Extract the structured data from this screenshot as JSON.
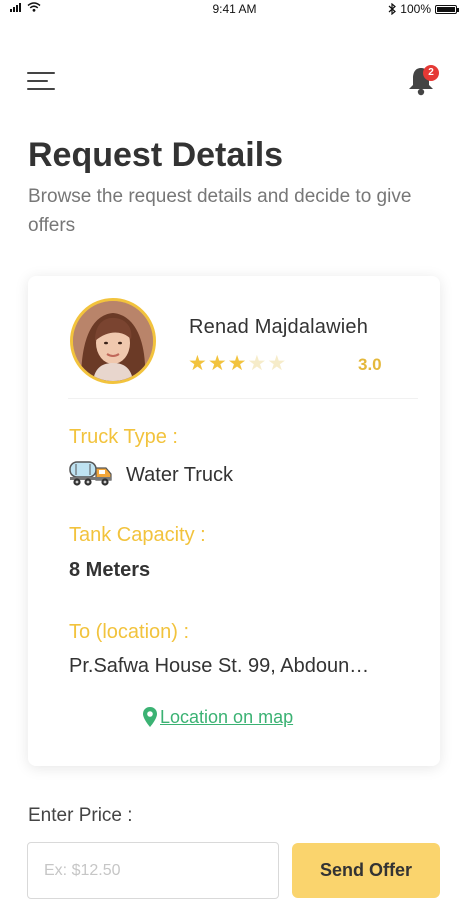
{
  "status_bar": {
    "time": "9:41 AM",
    "battery": "100%"
  },
  "header": {
    "notification_count": "2"
  },
  "page": {
    "title": "Request Details",
    "subtitle": "Browse the request details and decide to give offers"
  },
  "request": {
    "user_name": "Renad Majdalawieh",
    "rating_value": "3.0",
    "rating_stars_filled": 3,
    "rating_stars_total": 5,
    "truck_type_label": "Truck Type :",
    "truck_type_value": "Water Truck",
    "tank_capacity_label": "Tank Capacity :",
    "tank_capacity_value": "8 Meters",
    "location_label": "To (location) :",
    "location_value": "Pr.Safwa House St. 99, Abdoun…",
    "map_link_label": "Location on map"
  },
  "offer": {
    "price_label": "Enter Price :",
    "price_placeholder": "Ex: $12.50",
    "price_value": "",
    "send_button_label": "Send Offer"
  },
  "colors": {
    "accent_yellow": "#f2c33d",
    "button_yellow": "#fad46d",
    "link_green": "#3bb273",
    "badge_red": "#e53935"
  },
  "icons": [
    "signal-icon",
    "wifi-icon",
    "bluetooth-icon",
    "battery-icon",
    "menu-icon",
    "bell-icon",
    "star-icon",
    "truck-icon",
    "map-pin-icon"
  ]
}
